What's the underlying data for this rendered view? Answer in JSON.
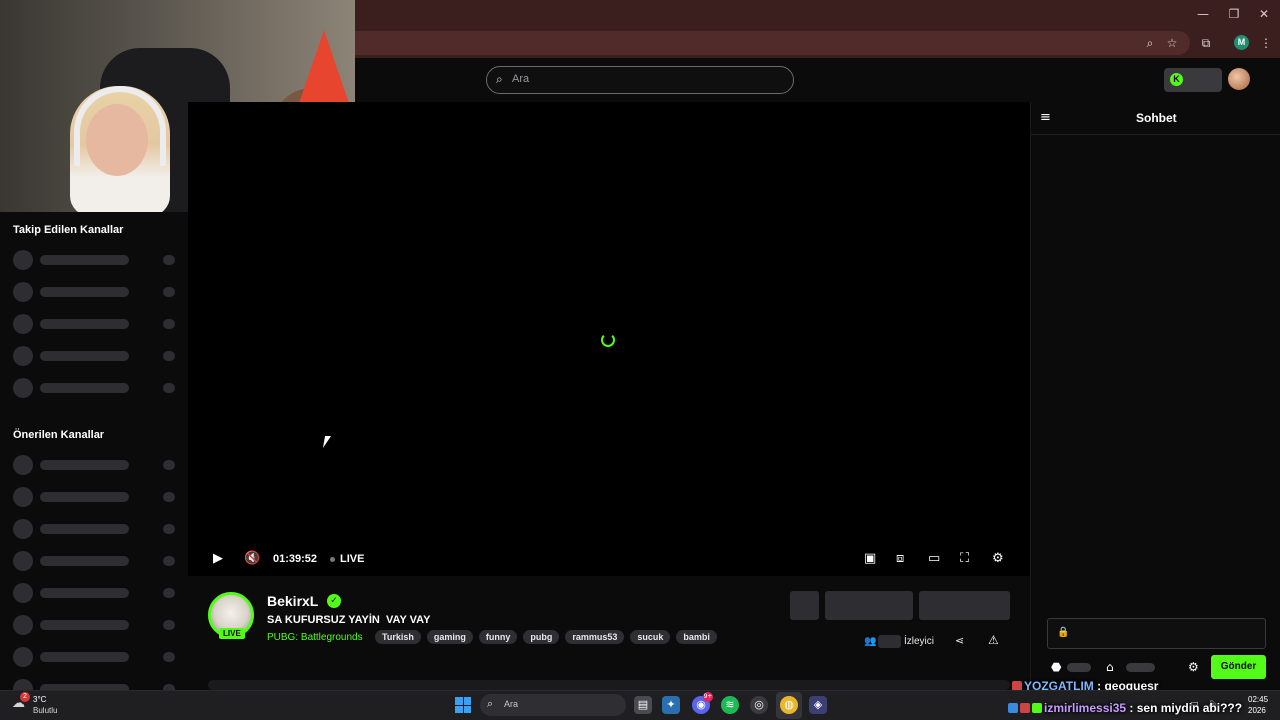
{
  "browser": {
    "minimize_icon": "minimize-icon",
    "restore_icon": "restore-icon",
    "close_icon": "close-icon",
    "zoom_icon": "zoom-icon",
    "star_icon": "bookmark-star-icon",
    "extensions_icon": "extensions-icon",
    "profile_initial": "M",
    "menu_icon": "menu-dots-icon"
  },
  "header": {
    "search_placeholder": "Ara",
    "search_icon": "search-icon"
  },
  "sidebar": {
    "followed_title": "Takip Edilen Kanallar",
    "recommended_title": "Önerilen Kanallar"
  },
  "player": {
    "time": "01:39:52",
    "live_label": "LIVE",
    "state": "loading"
  },
  "channel": {
    "name": "BekirxL",
    "live_badge": "LIVE",
    "title": "SA KUFURSUZ YAYİN  VAY VAY",
    "category": "PUBG: Battlegrounds",
    "tags": [
      "Turkish",
      "gaming",
      "funny",
      "pubg",
      "rammus53",
      "sucuk",
      "bambi"
    ],
    "viewer_label": "İzleyici"
  },
  "chat": {
    "title": "Sohbet",
    "send_label": "Gönder"
  },
  "chat_overlay": [
    {
      "user": "YOZGATLIM",
      "text": " : geoguesr"
    },
    {
      "user": "izmirlimessi35",
      "text": " : sen miydin abi???"
    }
  ],
  "taskbar": {
    "weather_badge": "2",
    "temperature": "3°C",
    "weather_desc": "Bulutlu",
    "search_placeholder": "Ara",
    "notif_badge": "9+",
    "clock_time": "02:45",
    "clock_date": "2026"
  },
  "colors": {
    "accent": "#53fc18",
    "titlebar": "#3b1f1f",
    "background": "#0b0b0c"
  }
}
